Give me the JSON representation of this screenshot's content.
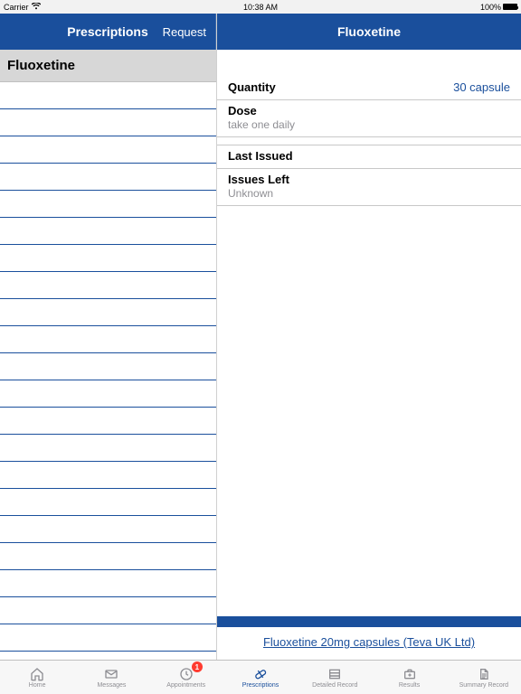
{
  "status": {
    "carrier": "Carrier",
    "time": "10:38 AM",
    "battery_pct": "100%"
  },
  "left": {
    "title": "Prescriptions",
    "action": "Request",
    "selected_item": "Fluoxetine"
  },
  "right": {
    "title": "Fluoxetine",
    "quantity": {
      "label": "Quantity",
      "value": "30 capsule"
    },
    "dose": {
      "label": "Dose",
      "value": "take one daily"
    },
    "last_issued": {
      "label": "Last Issued",
      "value": ""
    },
    "issues_left": {
      "label": "Issues Left",
      "value": "Unknown"
    },
    "footer_link": "Fluoxetine 20mg capsules (Teva UK Ltd)"
  },
  "tabs": {
    "home": "Home",
    "messages": "Messages",
    "appointments": "Appointments",
    "appointments_badge": "1",
    "prescriptions": "Prescriptions",
    "detailed": "Detailed Record",
    "results": "Results",
    "summary": "Summary Record"
  }
}
